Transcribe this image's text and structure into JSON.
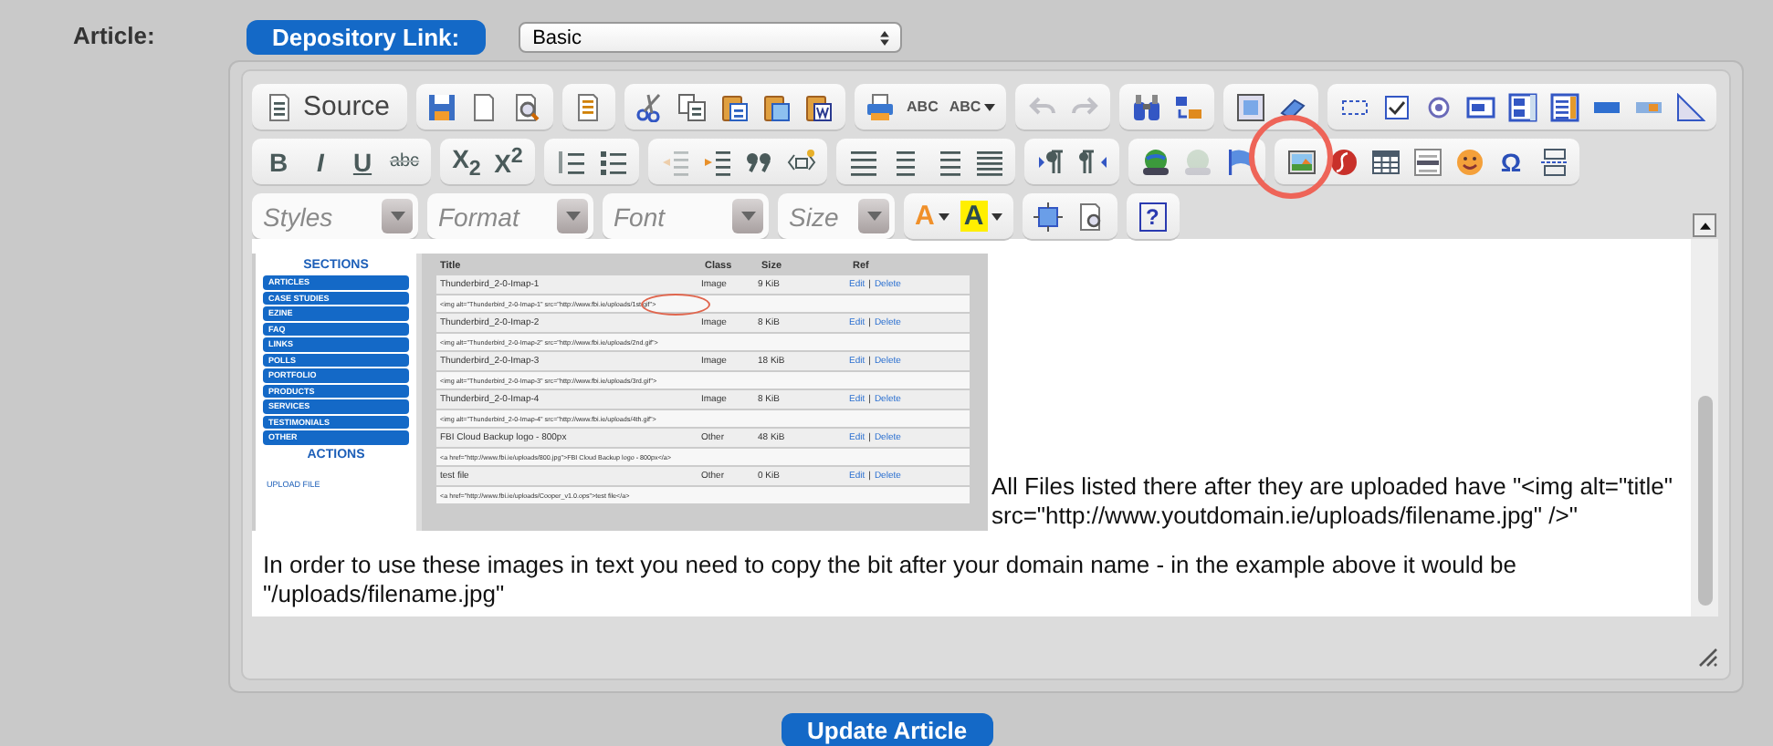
{
  "field_label": "Article:",
  "depository_button": "Depository Link:",
  "toolbar_select": {
    "value": "Basic"
  },
  "editor": {
    "toolbar": {
      "source_label": "Source",
      "letter_buttons": [
        {
          "text": "ABC"
        },
        {
          "text": "ABC"
        },
        {
          "text": "B"
        },
        {
          "text": "I"
        },
        {
          "text": "U"
        },
        {
          "text": "abc"
        },
        {
          "text": "X$_{2}$"
        },
        {
          "text": "X$^{2}$"
        },
        {
          "text": "Ω"
        },
        {
          "text": "A"
        },
        {
          "text": "A"
        },
        {
          "text": "?"
        }
      ],
      "history_buttons": [
        {
          "disabled": true
        },
        {
          "disabled": true
        }
      ],
      "outdent_disabled": true,
      "unlink_disabled": true,
      "combos": [
        {
          "placeholder": "Styles"
        },
        {
          "placeholder": "Format"
        },
        {
          "placeholder": "Font"
        },
        {
          "placeholder": "Size"
        }
      ]
    },
    "content": {
      "screenshot": {
        "sections_heading": "SECTIONS",
        "sections": [
          "ARTICLES",
          "CASE STUDIES",
          "EZINE",
          "FAQ",
          "LINKS",
          "POLLS",
          "PORTFOLIO",
          "PRODUCTS",
          "SERVICES",
          "TESTIMONIALS",
          "OTHER"
        ],
        "actions_heading": "ACTIONS",
        "actions": [
          "UPLOAD FILE"
        ],
        "columns": [
          "Title",
          "Class",
          "Size",
          "Ref"
        ],
        "rows": [
          {
            "title": "Thunderbird_2-0-Imap-1",
            "class": "Image",
            "size": "9 KiB",
            "edit": "Edit",
            "separator": "|",
            "delete": "Delete",
            "code": "<img alt=\"Thunderbird_2-0-Imap-1\" src=\"http://www.fbi.ie/uploads/1st.gif\">"
          },
          {
            "title": "Thunderbird_2-0-Imap-2",
            "class": "Image",
            "size": "8 KiB",
            "edit": "Edit",
            "separator": "|",
            "delete": "Delete",
            "code": "<img alt=\"Thunderbird_2-0-Imap-2\" src=\"http://www.fbi.ie/uploads/2nd.gif\">"
          },
          {
            "title": "Thunderbird_2-0-Imap-3",
            "class": "Image",
            "size": "18 KiB",
            "edit": "Edit",
            "separator": "|",
            "delete": "Delete",
            "code": "<img alt=\"Thunderbird_2-0-Imap-3\" src=\"http://www.fbi.ie/uploads/3rd.gif\">"
          },
          {
            "title": "Thunderbird_2-0-Imap-4",
            "class": "Image",
            "size": "8 KiB",
            "edit": "Edit",
            "separator": "|",
            "delete": "Delete",
            "code": "<img alt=\"Thunderbird_2-0-Imap-4\" src=\"http://www.fbi.ie/uploads/4th.gif\">"
          },
          {
            "title": "FBI Cloud Backup logo - 800px",
            "class": "Other",
            "size": "48 KiB",
            "edit": "Edit",
            "separator": "|",
            "delete": "Delete",
            "code": "<a href=\"http://www.fbi.ie/uploads/800.jpg\">FBI Cloud Backup logo - 800px</a>"
          },
          {
            "title": "test file",
            "class": "Other",
            "size": "0 KiB",
            "edit": "Edit",
            "separator": "|",
            "delete": "Delete",
            "code": "<a href=\"http://www.fbi.ie/uploads/Cooper_v1.0.ops\">test file</a>"
          }
        ]
      },
      "paragraph_1": "All Files listed there after they are uploaded have \"<img alt=\"title\" src=\"http://www.youtdomain.ie/uploads/filename.jpg\" />\"",
      "paragraph_2": "In order to use these images in text you need to copy the bit after your domain name - in the example above it would be \"/uploads/filename.jpg\""
    }
  },
  "update_button": "Update Article"
}
